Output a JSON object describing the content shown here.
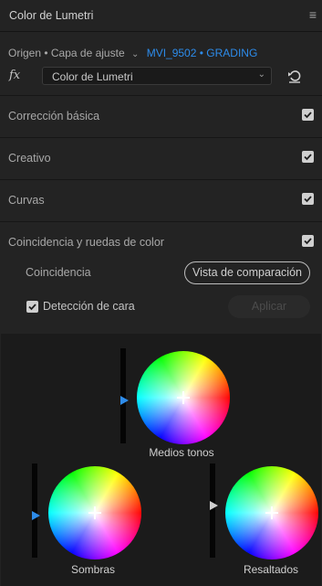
{
  "panel": {
    "title": "Color de Lumetri",
    "menu_icon": "hamburger-menu-icon"
  },
  "source": {
    "origin": "Origen • Capa de ajuste",
    "clip": "MVI_9502 • GRADING",
    "clip_color": "#2d8ceb"
  },
  "effect": {
    "fx_label": "fx",
    "selected": "Color de Lumetri",
    "reset_icon": "reset-icon"
  },
  "sections": [
    {
      "label": "Corrección básica",
      "checked": true
    },
    {
      "label": "Creativo",
      "checked": true
    },
    {
      "label": "Curvas",
      "checked": true
    },
    {
      "label": "Coincidencia y ruedas de color",
      "checked": true
    }
  ],
  "coincidence": {
    "label": "Coincidencia",
    "compare_button": "Vista de comparación",
    "face_detection_label": "Detección de cara",
    "face_detection_checked": true,
    "apply_button": "Aplicar",
    "apply_enabled": false
  },
  "wheels": [
    {
      "name": "Medios tonos",
      "level": 0.45,
      "thumb_color": "#2d8ceb"
    },
    {
      "name": "Sombras",
      "level": 0.45,
      "thumb_color": "#2d8ceb"
    },
    {
      "name": "Resaltados",
      "level": 0.55,
      "thumb_color": "#cfcfcf"
    }
  ]
}
